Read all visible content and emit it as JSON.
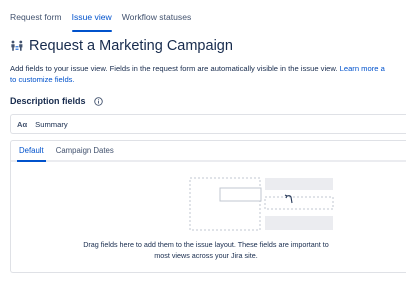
{
  "top_tabs": [
    {
      "label": "Request form",
      "active": false
    },
    {
      "label": "Issue view",
      "active": true
    },
    {
      "label": "Workflow statuses",
      "active": false
    }
  ],
  "title": "Request a Marketing Campaign",
  "title_icon": "people-figures-icon",
  "description": {
    "line1_text": "Add fields to your issue view. Fields in the request form are automatically visible in the issue view. ",
    "line1_link": "Learn more a",
    "line2_link": "to customize fields."
  },
  "section": {
    "title": "Description fields",
    "info_icon": "info-icon"
  },
  "fields": [
    {
      "type_glyph": "Aα",
      "label": "Summary"
    }
  ],
  "panel": {
    "tabs": [
      {
        "label": "Default",
        "active": true
      },
      {
        "label": "Campaign Dates",
        "active": false
      }
    ],
    "empty_line1": "Drag fields here to add them to the issue layout. These fields are important to",
    "empty_line2": "most views across your Jira site."
  },
  "colors": {
    "accent": "#0052cc",
    "text": "#172b4d",
    "muted": "#42526e",
    "border": "#dfe1e6",
    "placeholder": "#ebecf0"
  }
}
